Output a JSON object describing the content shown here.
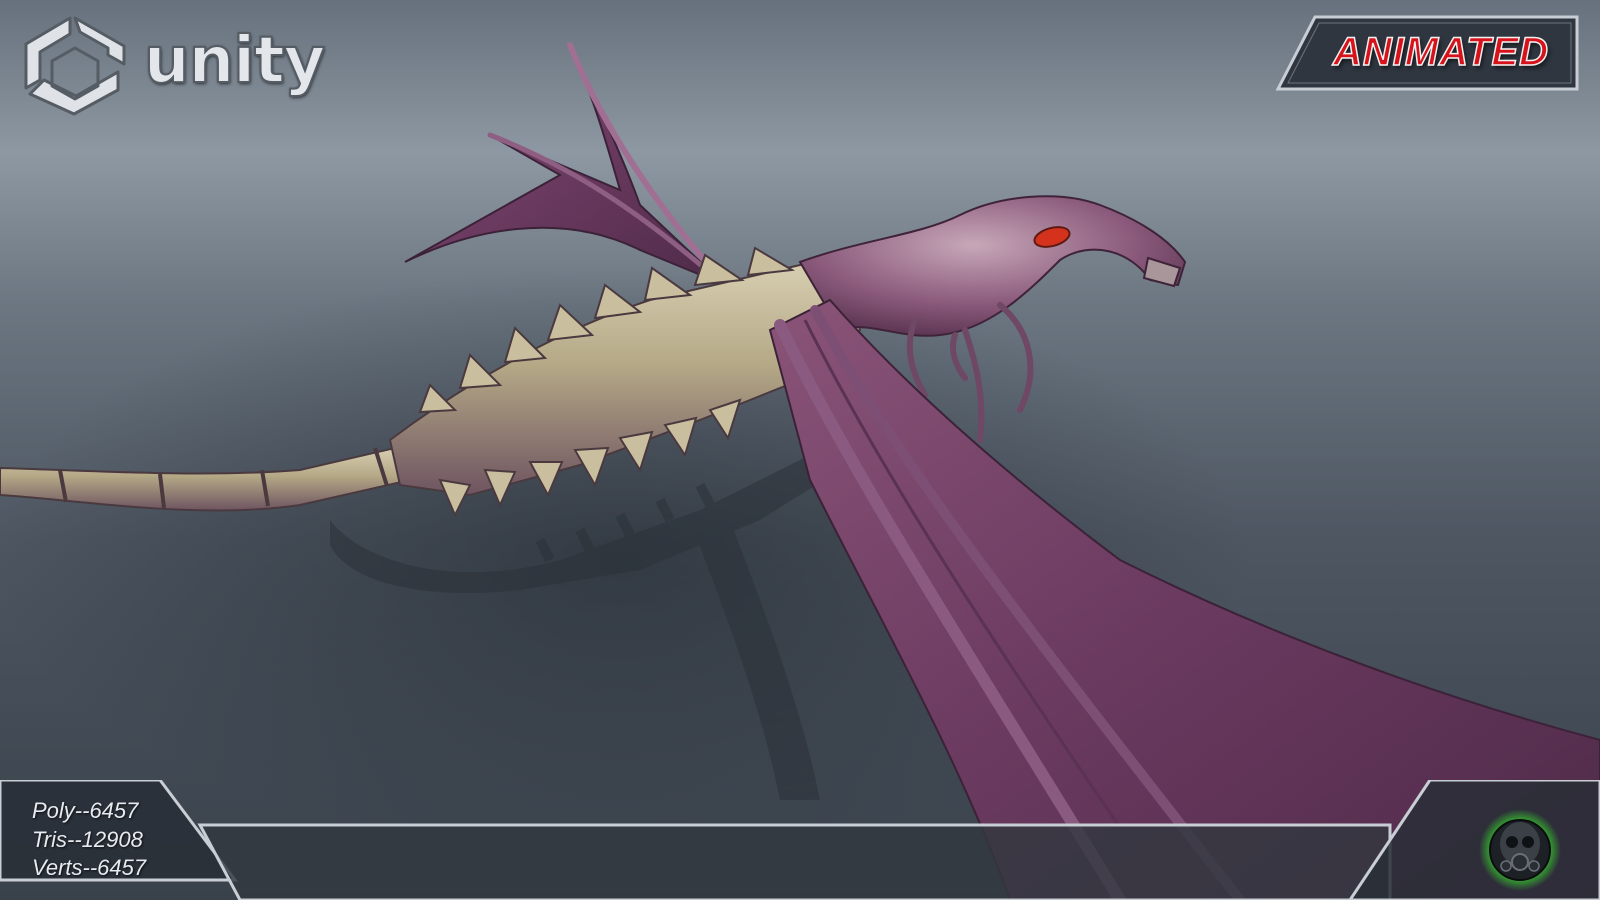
{
  "brand": {
    "logo_icon": "unity-cube-icon",
    "logo_word": "unity"
  },
  "badge": {
    "label": "ANIMATED",
    "color": "#d8121a"
  },
  "stats": {
    "poly": "Poly--6457",
    "tris": "Tris--12908",
    "verts": "Verts--6457"
  },
  "corner_icon": "gas-mask-icon",
  "colors": {
    "wing_membrane": "#6f3f64",
    "body_bone": "#b9ae8e",
    "eye": "#d4321c",
    "hud_frame": "#c9ced4"
  }
}
